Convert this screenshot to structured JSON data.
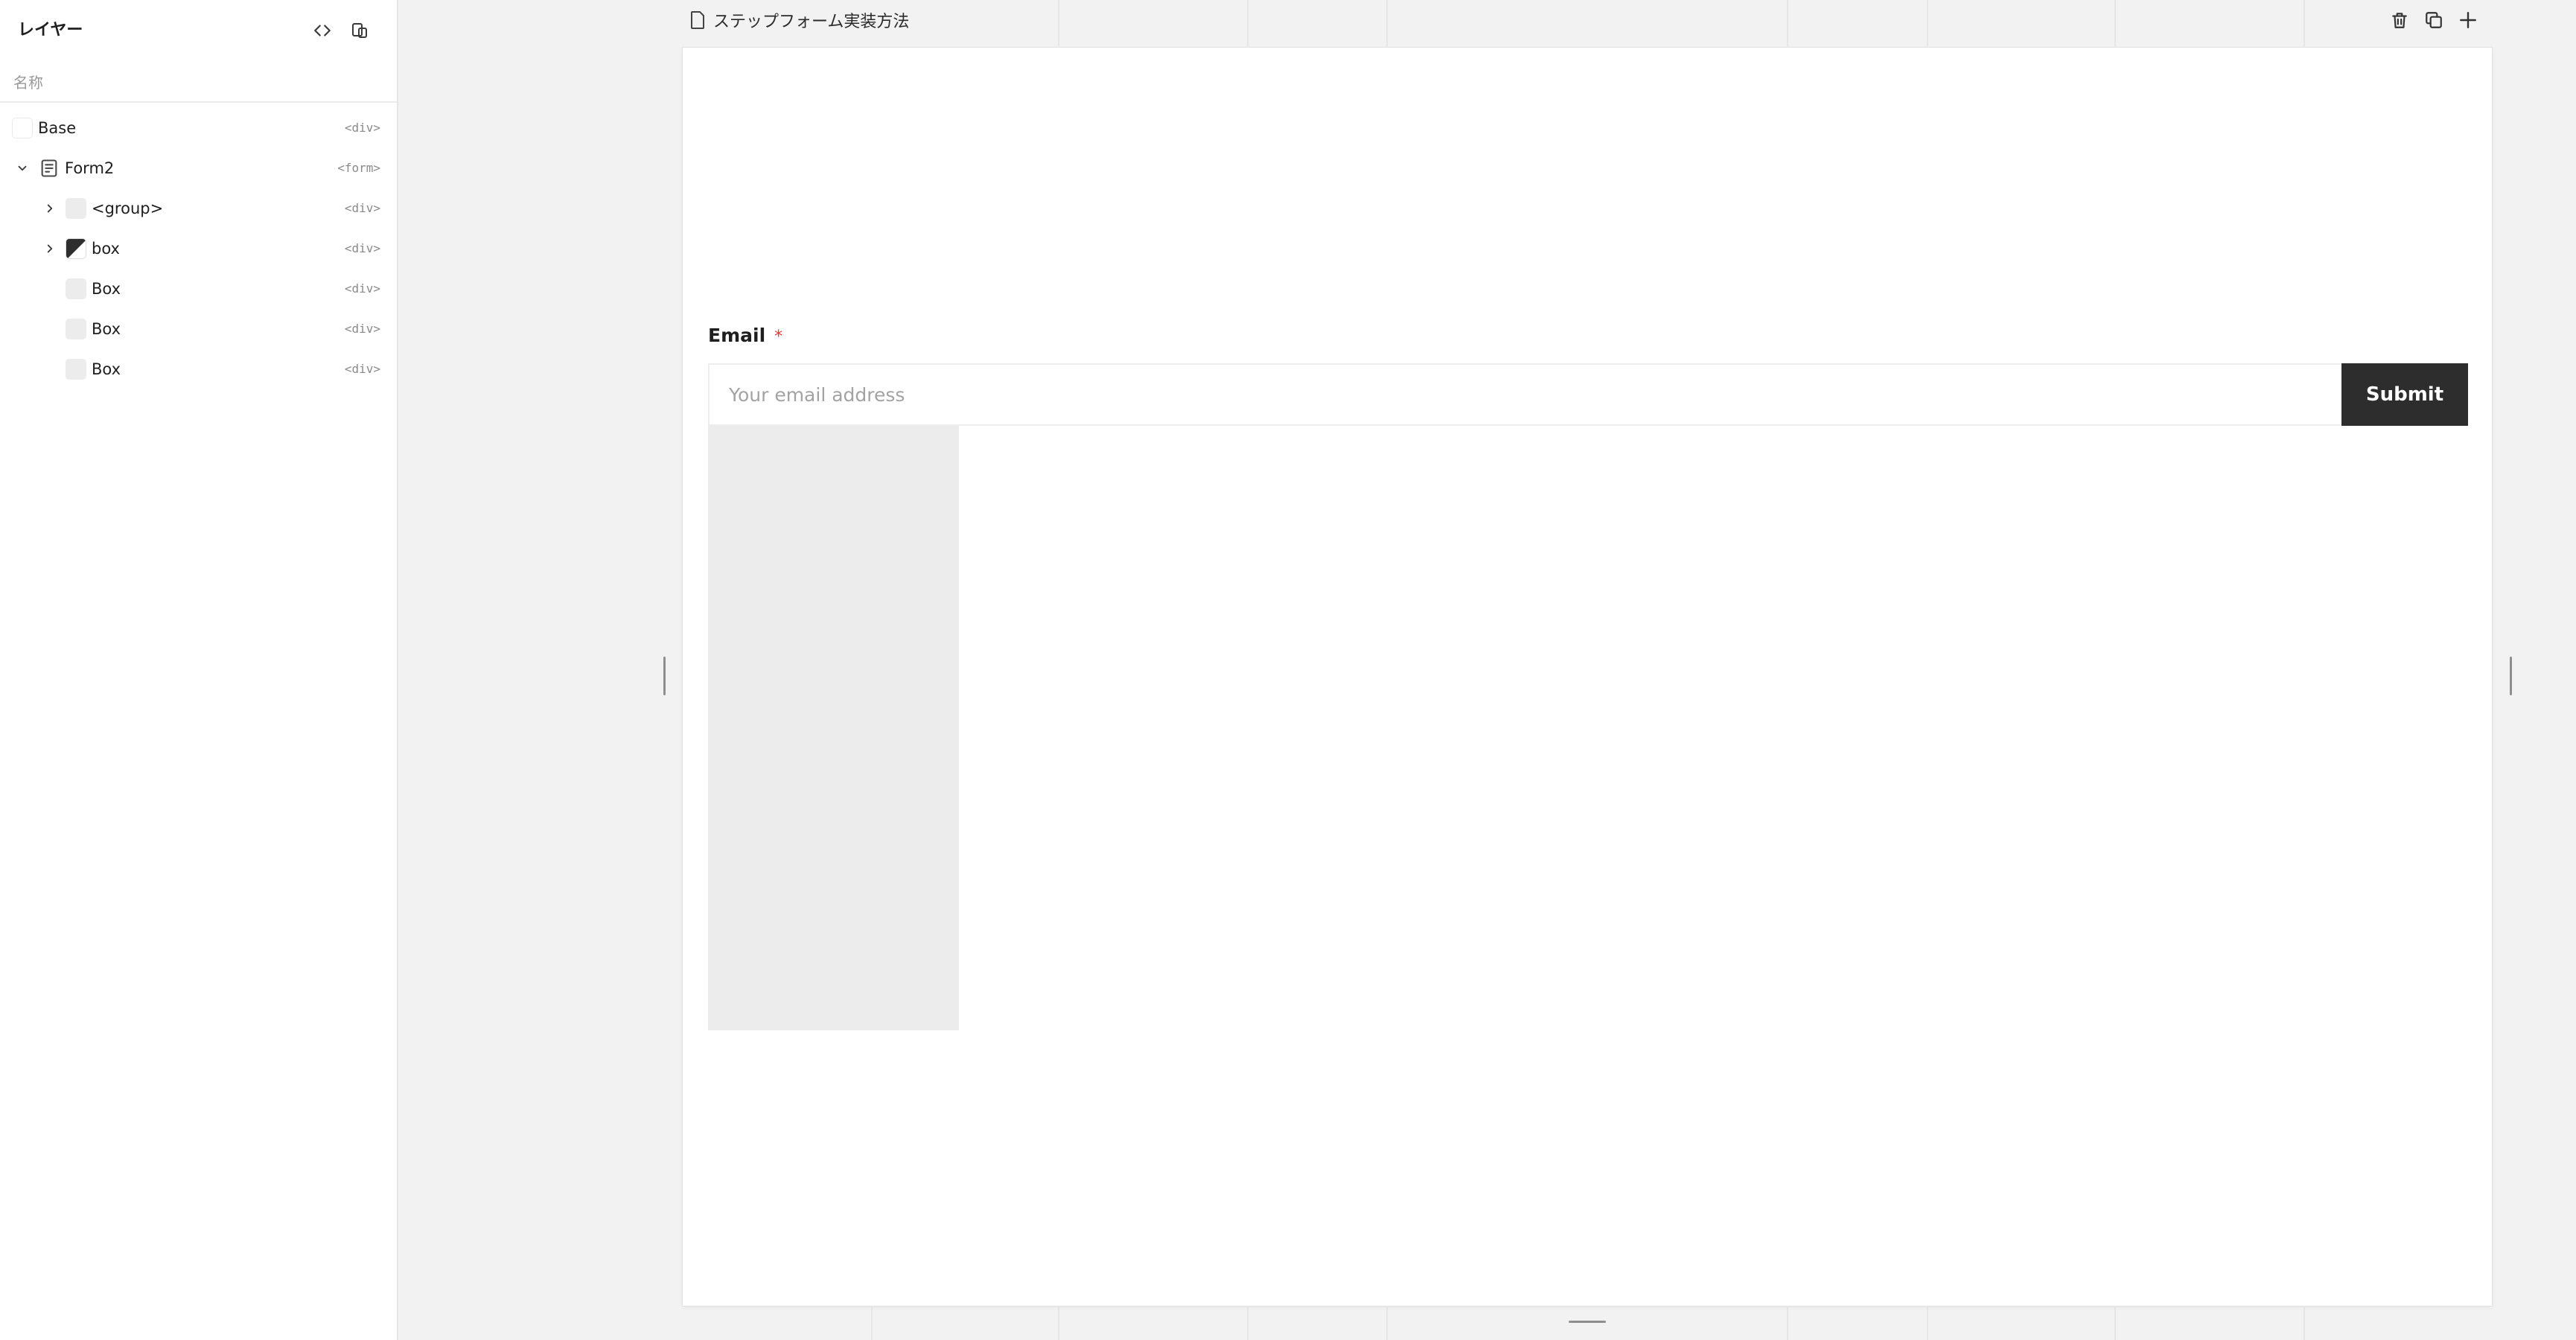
{
  "sidebar": {
    "title": "レイヤー",
    "search_placeholder": "名称",
    "icons": {
      "code_toggle": "code-view-icon",
      "copy_page": "copy-page-icon"
    },
    "layers": [
      {
        "name": "Base",
        "tag": "<div>",
        "thumb": "white"
      },
      {
        "name": "Form2",
        "tag": "<form>",
        "thumb": "form-icon",
        "expanded": true
      },
      {
        "name": "<group>",
        "tag": "<div>",
        "thumb": "grey",
        "collapsed": true
      },
      {
        "name": "box",
        "tag": "<div>",
        "thumb": "dark-diagonal",
        "collapsed": true
      },
      {
        "name": "Box",
        "tag": "<div>",
        "thumb": "grey"
      },
      {
        "name": "Box",
        "tag": "<div>",
        "thumb": "grey"
      },
      {
        "name": "Box",
        "tag": "<div>",
        "thumb": "grey"
      }
    ]
  },
  "canvas": {
    "document_title": "ステップフォーム実装方法",
    "actions": [
      "trash-icon",
      "duplicate-icon",
      "add-icon"
    ],
    "form": {
      "email_label": "Email",
      "required_mark": "*",
      "email_placeholder": "Your email address",
      "submit_label": "Submit"
    }
  },
  "colors": {
    "accent_required": "#e53935",
    "submit_bg": "#2d2d2d",
    "canvas_bg": "#f2f2f2"
  }
}
